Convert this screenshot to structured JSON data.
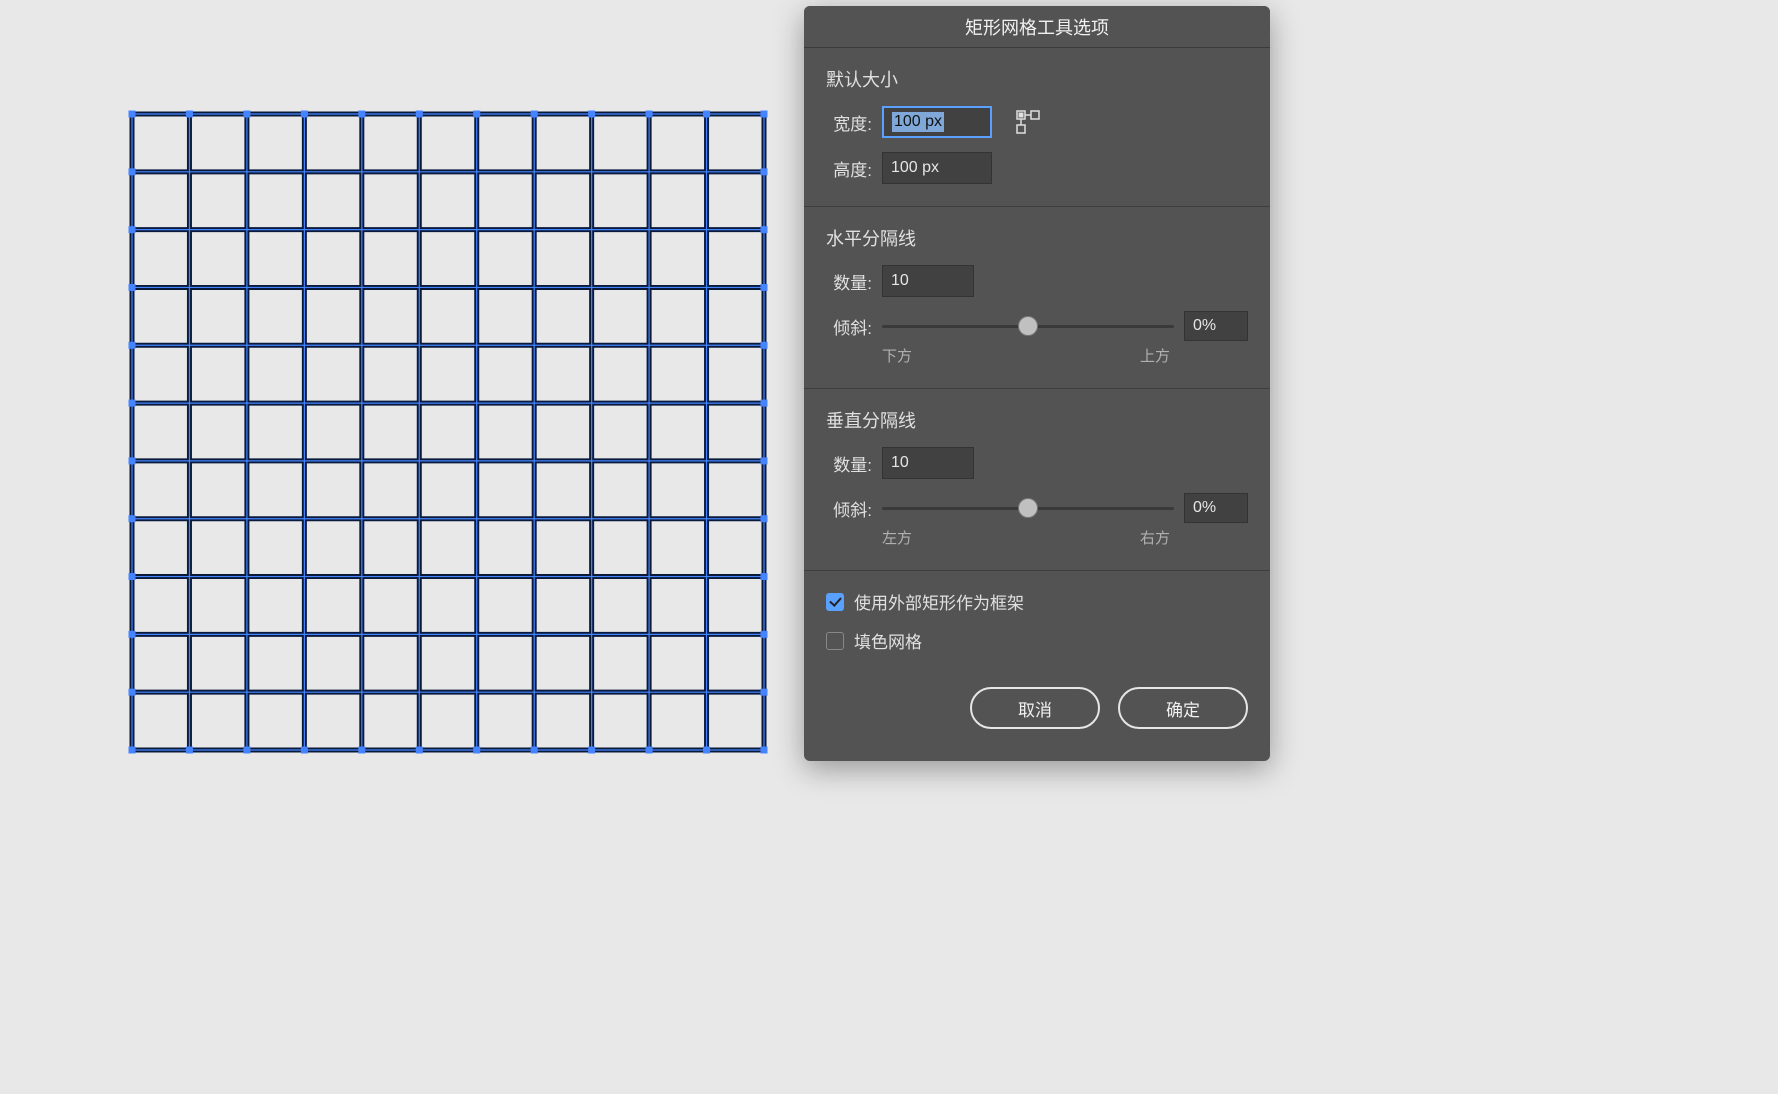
{
  "dialog": {
    "title": "矩形网格工具选项",
    "default_size": {
      "heading": "默认大小",
      "width_label": "宽度:",
      "width_value": "100 px",
      "height_label": "高度:",
      "height_value": "100 px"
    },
    "horizontal_dividers": {
      "heading": "水平分隔线",
      "count_label": "数量:",
      "count_value": "10",
      "skew_label": "倾斜:",
      "skew_value": "0%",
      "skew_min_label": "下方",
      "skew_max_label": "上方"
    },
    "vertical_dividers": {
      "heading": "垂直分隔线",
      "count_label": "数量:",
      "count_value": "10",
      "skew_label": "倾斜:",
      "skew_value": "0%",
      "skew_min_label": "左方",
      "skew_max_label": "右方"
    },
    "options": {
      "use_outer_rect_label": "使用外部矩形作为框架",
      "use_outer_rect_checked": true,
      "fill_grid_label": "填色网格",
      "fill_grid_checked": false
    },
    "buttons": {
      "cancel": "取消",
      "ok": "确定"
    }
  },
  "canvas": {
    "horizontal_dividers": 10,
    "vertical_dividers": 10
  }
}
